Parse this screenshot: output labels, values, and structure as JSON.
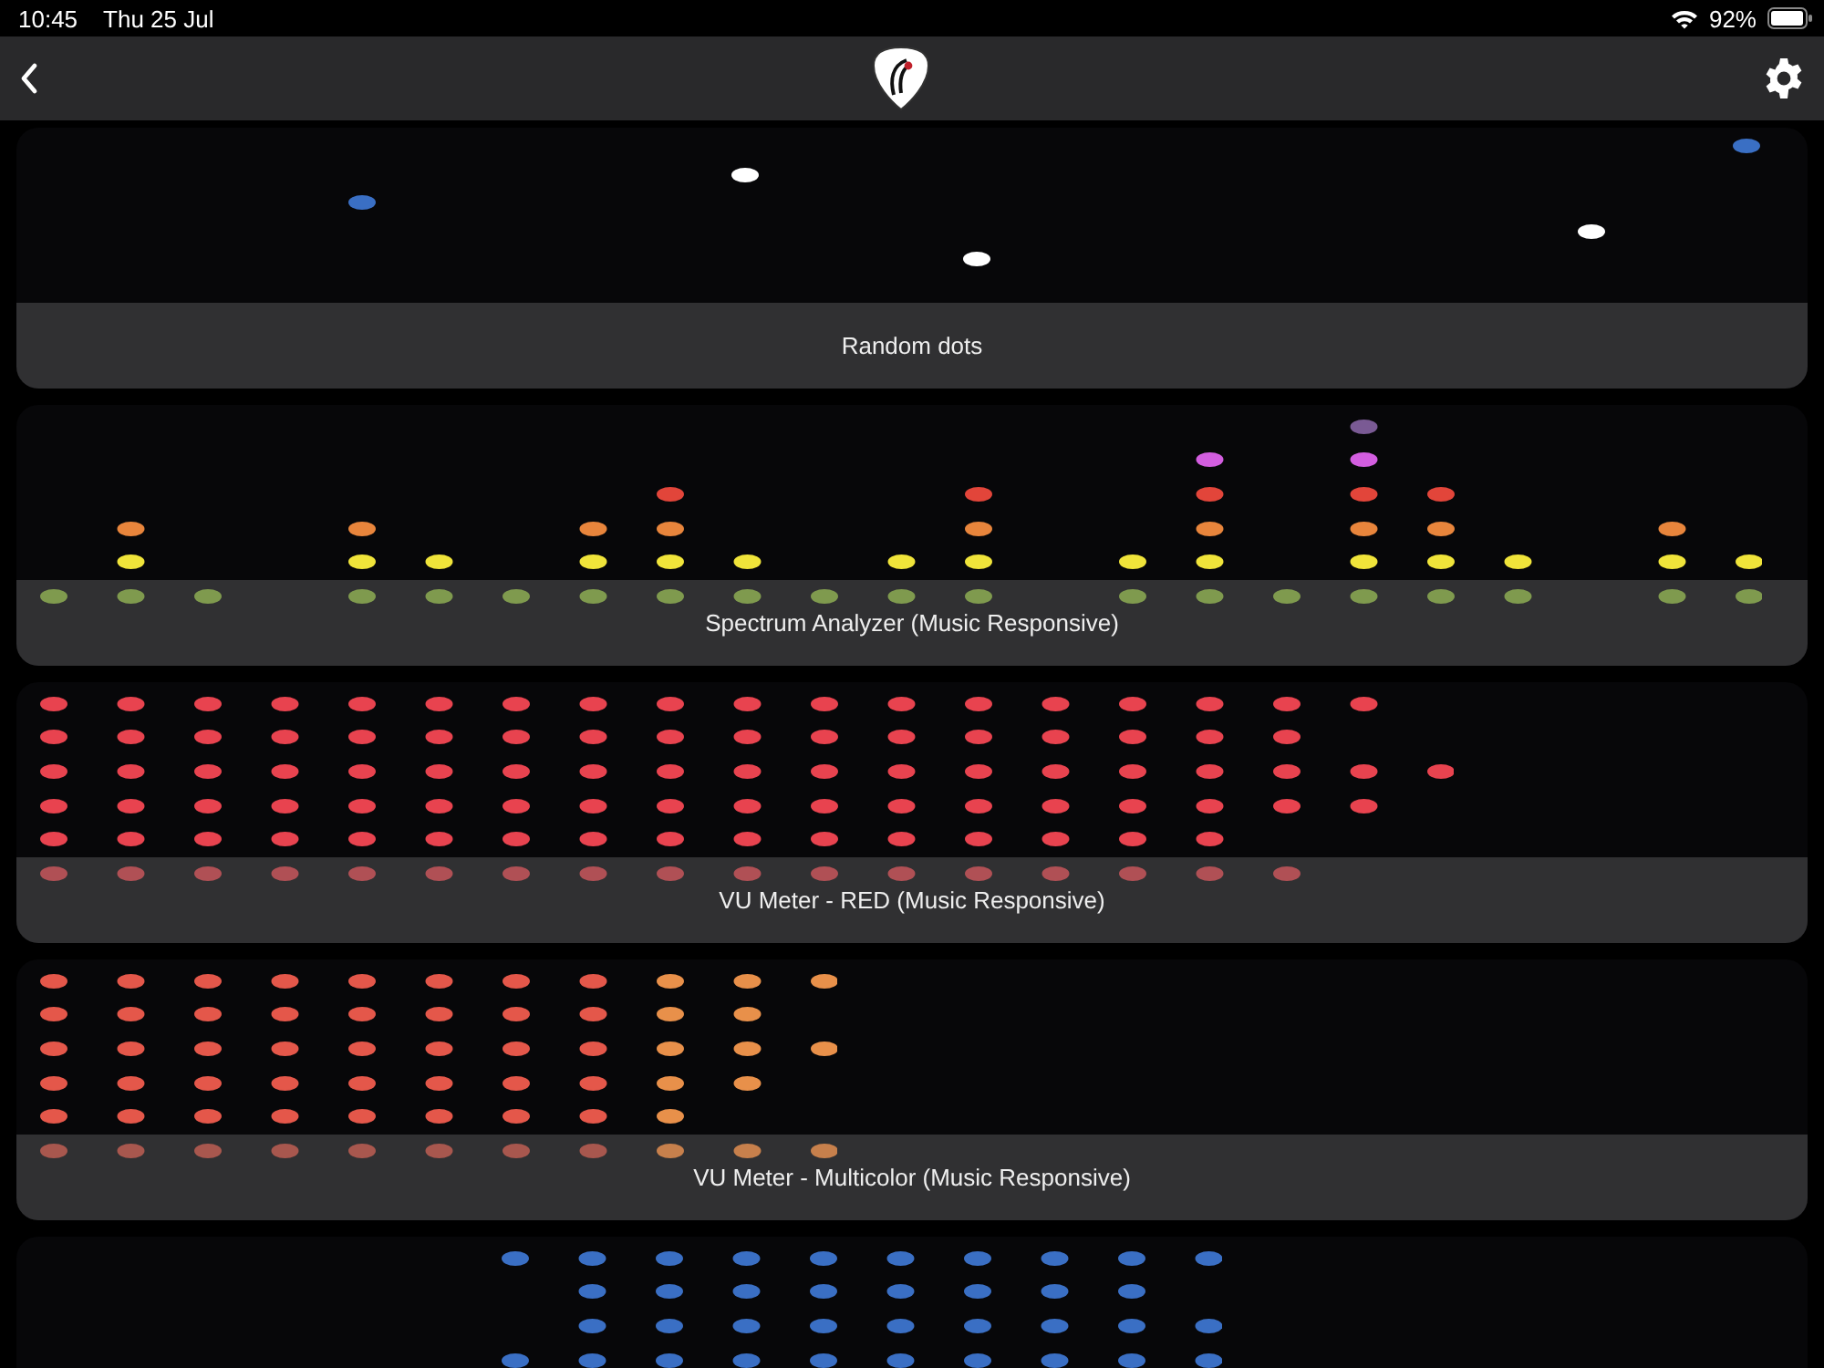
{
  "status_bar": {
    "time": "10:45",
    "date": "Thu 25 Jul",
    "battery": "92%"
  },
  "effects": [
    {
      "kind": "random",
      "title": "Random dots"
    },
    {
      "kind": "spectrum",
      "title": "Spectrum Analyzer (Music Responsive)"
    },
    {
      "kind": "vu_red",
      "title": "VU Meter - RED (Music Responsive)"
    },
    {
      "kind": "vu_multi",
      "title": "VU Meter - Multicolor (Music Responsive)"
    },
    {
      "kind": "vu_blue"
    }
  ]
}
